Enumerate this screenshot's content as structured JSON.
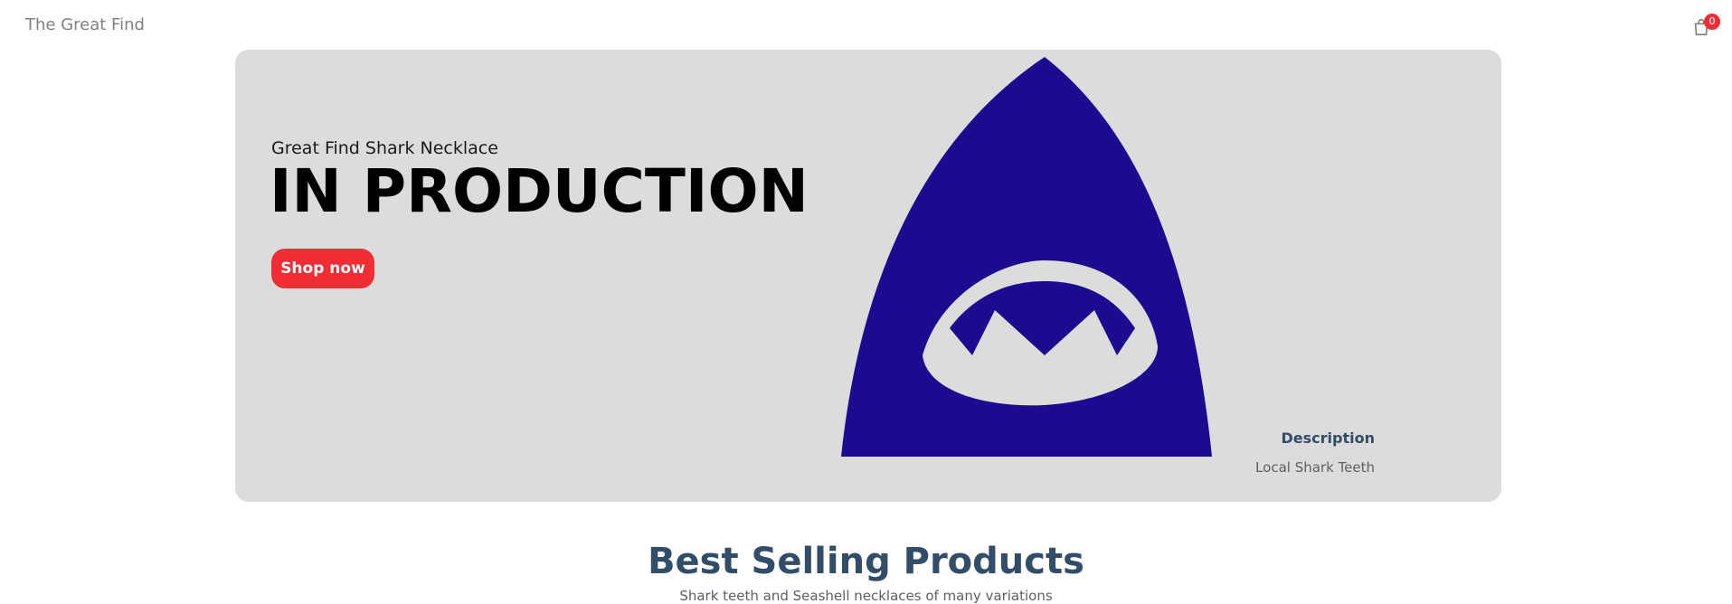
{
  "navbar": {
    "logo": "The Great Find",
    "cart_count": "0",
    "cart_icon": "shopping-bag-icon"
  },
  "hero": {
    "small_text": "Great Find Shark Necklace",
    "headline": "IN PRODUCTION",
    "button_label": "Shop now",
    "image_icon": "shark-tooth-logo",
    "description_title": "Description",
    "description_text": "Local Shark Teeth",
    "colors": {
      "background": "#dcdcdc",
      "accent": "#f02d34",
      "logo_blue": "#1b0b8e"
    }
  },
  "products": {
    "heading": "Best Selling Products",
    "subheading": "Shark teeth and Seashell necklaces of many variations"
  }
}
